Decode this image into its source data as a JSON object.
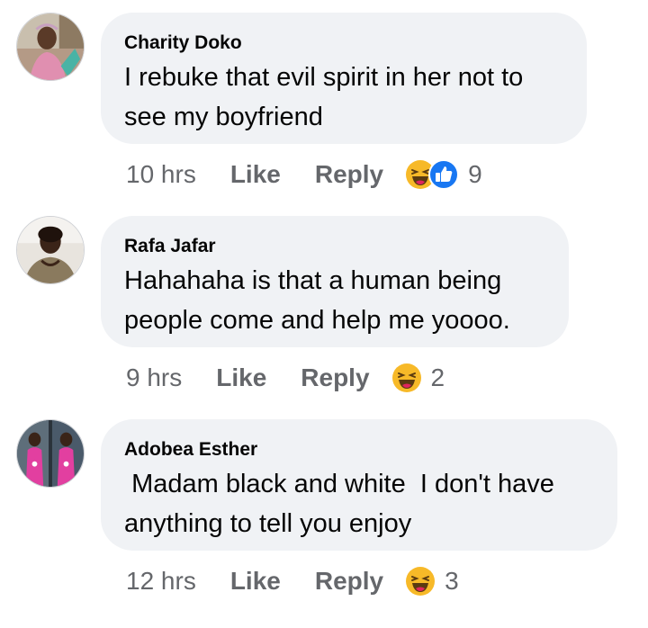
{
  "comments": [
    {
      "author": "Charity Doko",
      "text": "I rebuke that evil spirit in her not to see my boyfriend",
      "time": "10 hrs",
      "like_label": "Like",
      "reply_label": "Reply",
      "reactions": [
        "haha-icon",
        "like-icon"
      ],
      "reaction_count": "9"
    },
    {
      "author": "Rafa Jafar",
      "text": "Hahahaha is that a human being people come and help me yoooo.",
      "time": "9 hrs",
      "like_label": "Like",
      "reply_label": "Reply",
      "reactions": [
        "haha-icon"
      ],
      "reaction_count": "2"
    },
    {
      "author": "Adobea Esther",
      "text": " Madam black and white  I don't have anything to tell you enjoy",
      "time": "12 hrs",
      "like_label": "Like",
      "reply_label": "Reply",
      "reactions": [
        "haha-icon"
      ],
      "reaction_count": "3"
    }
  ],
  "colors": {
    "bubble": "#f0f2f5",
    "text": "#050505",
    "meta": "#65676b",
    "like_blue": "#1877f2",
    "haha_yellow": "#f7b928"
  }
}
